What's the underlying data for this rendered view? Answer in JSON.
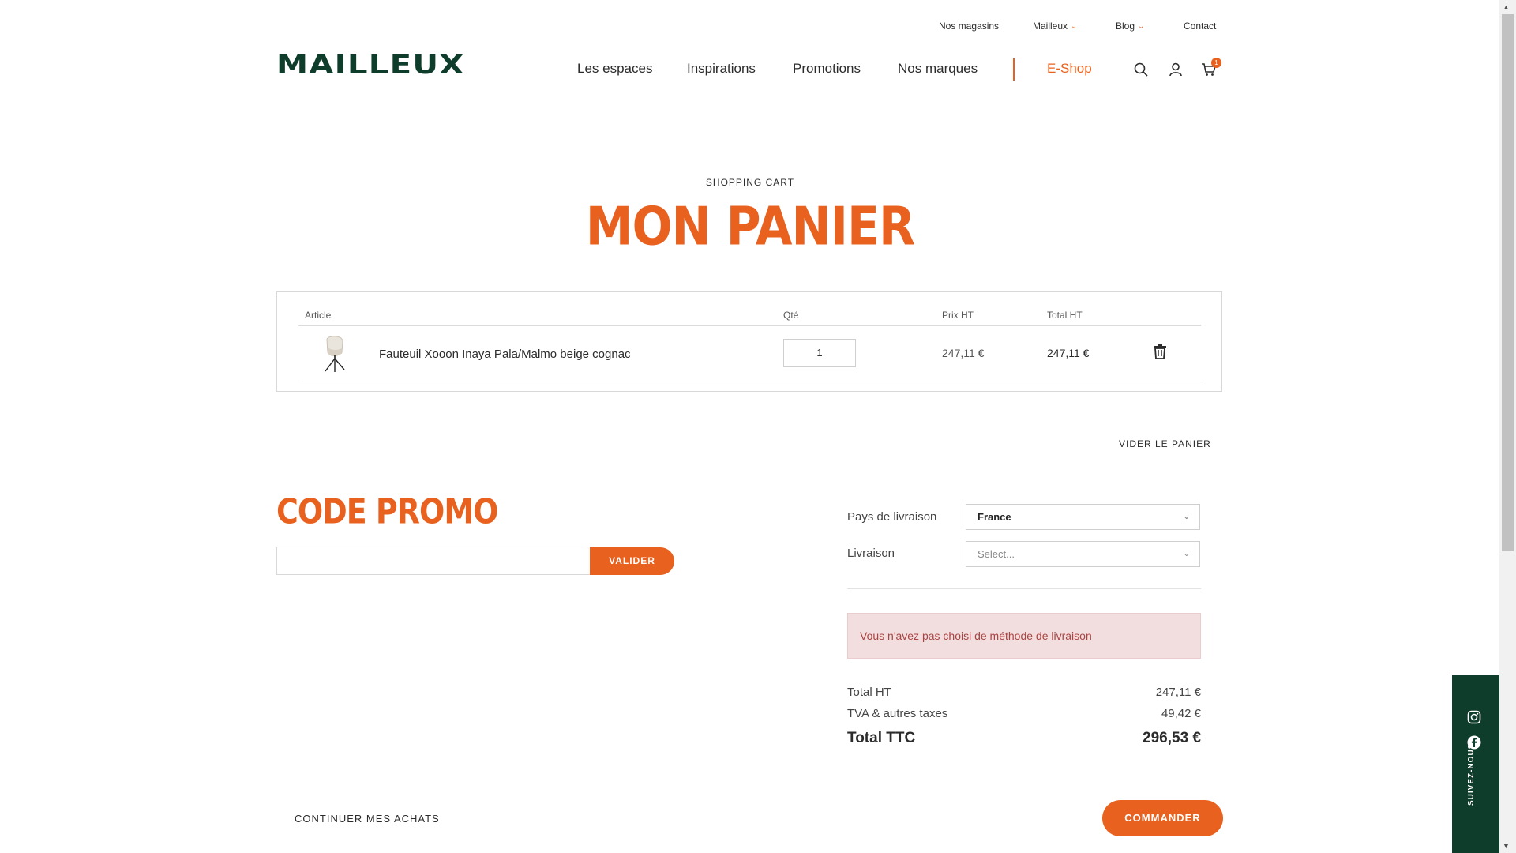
{
  "topbar": {
    "stores": "Nos magasins",
    "mailleux": "Mailleux",
    "blog": "Blog",
    "contact": "Contact"
  },
  "brand": {
    "logo": "MAILLEUX",
    "color": "#0f3d2c"
  },
  "nav": {
    "items": [
      "Les espaces",
      "Inspirations",
      "Promotions",
      "Nos marques"
    ],
    "eshop": "E-Shop",
    "cart_count": "1"
  },
  "accent": "#e8611f",
  "page": {
    "eyebrow": "SHOPPING CART",
    "title": "MON PANIER"
  },
  "cart": {
    "headers": {
      "article": "Article",
      "qty": "Qté",
      "price": "Prix HT",
      "total": "Total HT"
    },
    "items": [
      {
        "name": "Fauteuil Xooon Inaya Pala/Malmo beige cognac",
        "qty": "1",
        "price": "247,11 €",
        "total": "247,11 €"
      }
    ],
    "clear_label": "VIDER LE PANIER"
  },
  "promo": {
    "title": "CODE PROMO",
    "input_value": "",
    "button": "VALIDER"
  },
  "shipping": {
    "country_label": "Pays de livraison",
    "country_value": "France",
    "method_label": "Livraison",
    "method_placeholder": "Select...",
    "alert": "Vous n'avez pas choisi de méthode de livraison"
  },
  "totals": {
    "ht_label": "Total HT",
    "ht_value": "247,11 €",
    "tax_label": "TVA & autres taxes",
    "tax_value": "49,42 €",
    "ttc_label": "Total TTC",
    "ttc_value": "296,53 €"
  },
  "footer": {
    "continue": "CONTINUER MES ACHATS",
    "order": "COMMANDER"
  },
  "social": {
    "label": "SUIVEZ-NOUS",
    "icons": [
      "instagram-icon",
      "facebook-icon"
    ]
  }
}
